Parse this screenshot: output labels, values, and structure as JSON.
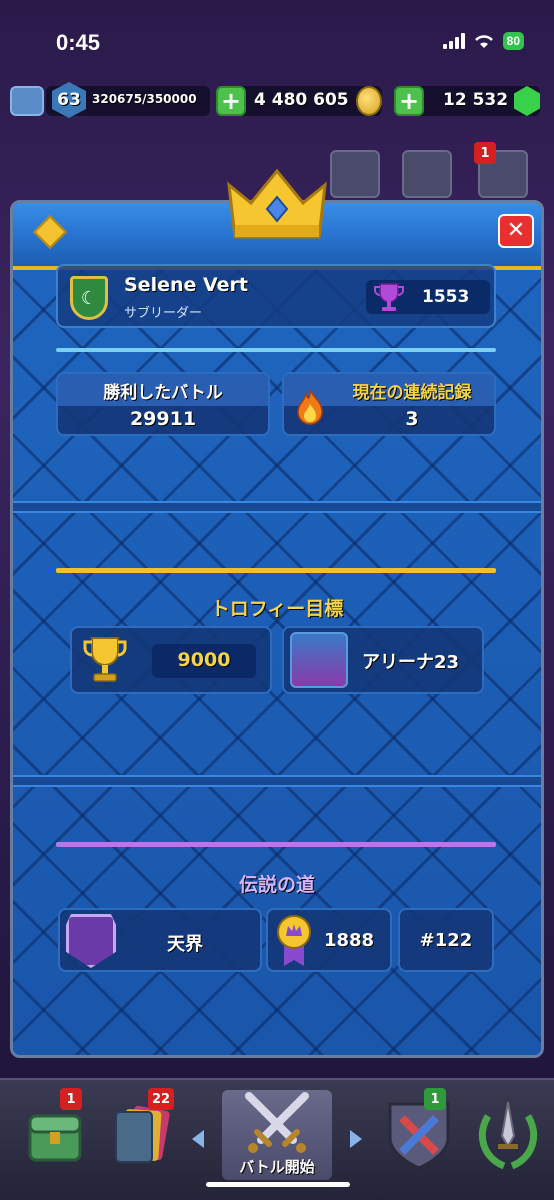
{
  "status_bar": {
    "time": "0:45",
    "battery": "80"
  },
  "hud": {
    "level": "63",
    "xp": "320675/350000",
    "gold": "4 480 605",
    "gems": "12 532",
    "notification_count": "1"
  },
  "header": {
    "icon": "diamond-icon",
    "close_icon": "close-icon"
  },
  "clan": {
    "name": "Selene Vert",
    "role": "サブリーダー",
    "trophies": "1553"
  },
  "stats": {
    "wins_label": "勝利したバトル",
    "wins_value": "29911",
    "streak_label": "現在の連続記録",
    "streak_value": "3"
  },
  "trophy_goal": {
    "title": "トロフィー目標",
    "trophies": "9000",
    "arena": "アリーナ23"
  },
  "path_of_legends": {
    "title": "伝説の道",
    "league": "天界",
    "rating": "1888",
    "rank": "#122"
  },
  "bottom_nav": {
    "shop_badge": "1",
    "cards_badge": "22",
    "battle_label": "バトル開始",
    "clan_badge": "1"
  },
  "colors": {
    "panel_blue": "#1b5fb4",
    "accent_gold": "#f0c02a",
    "cyan_divider": "#7ad0f0",
    "purple_divider": "#b27ae8",
    "streak_yellow": "#f5d34a"
  }
}
